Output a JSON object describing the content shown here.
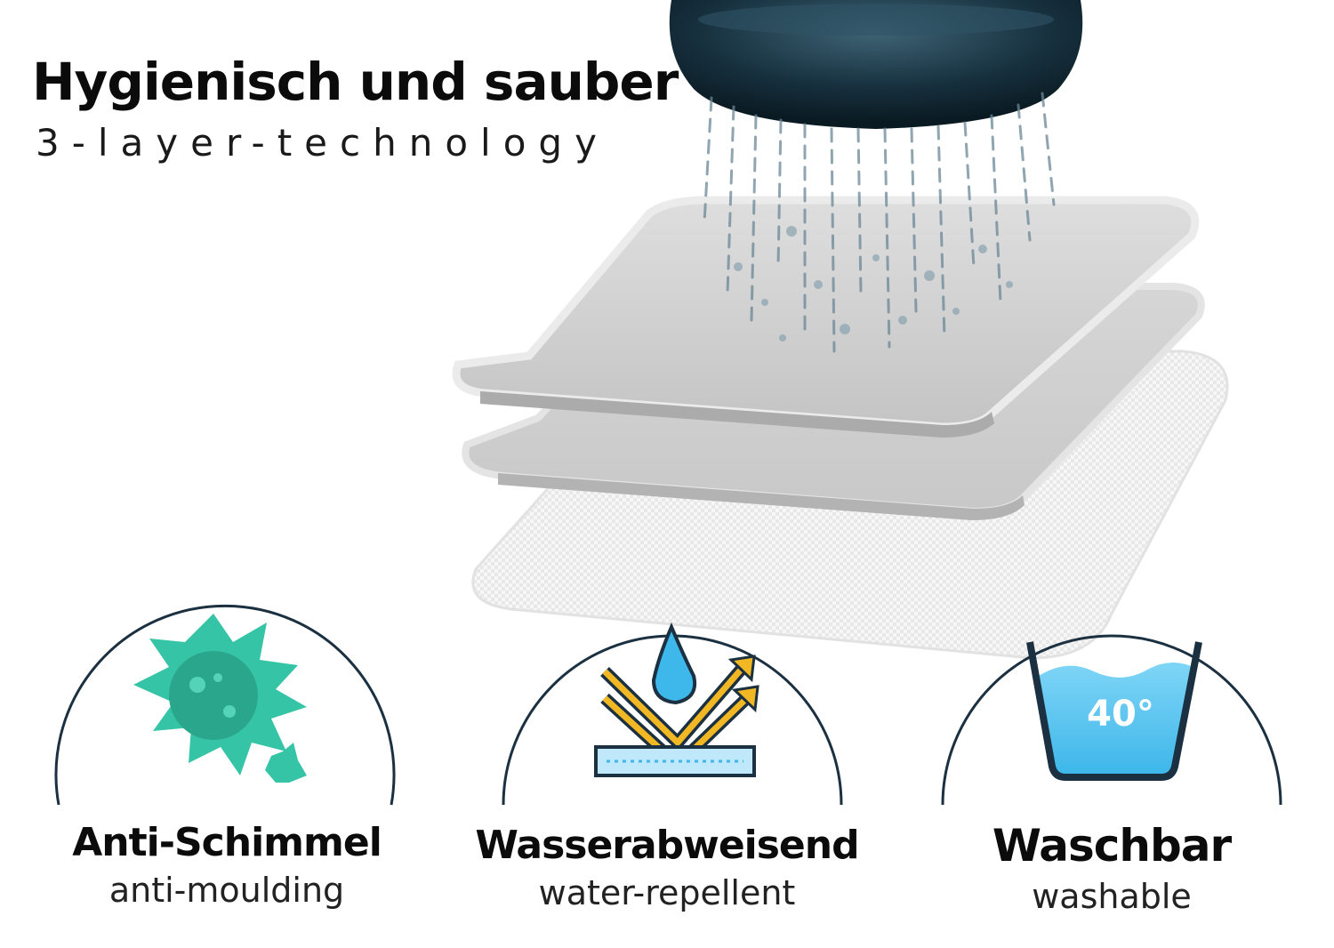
{
  "heading": {
    "title": "Hygienisch und sauber",
    "subtitle": "3-layer-technology"
  },
  "features": [
    {
      "title": "Anti-Schimmel",
      "subtitle": "anti-moulding",
      "icon": "mold-spore-icon"
    },
    {
      "title": "Wasserabweisend",
      "subtitle": "water-repellent",
      "icon": "water-repellent-icon"
    },
    {
      "title": "Waschbar",
      "subtitle": "washable",
      "icon": "wash-tub-icon",
      "badge": "40°"
    }
  ],
  "colors": {
    "circle_outline": "#1b3040",
    "mold_teal": "#35c4a6",
    "water_blue": "#3eb7ea",
    "arrow_gold": "#f2b823",
    "layer_gray": "#c8c8c8",
    "shower_dark": "#17313f"
  }
}
